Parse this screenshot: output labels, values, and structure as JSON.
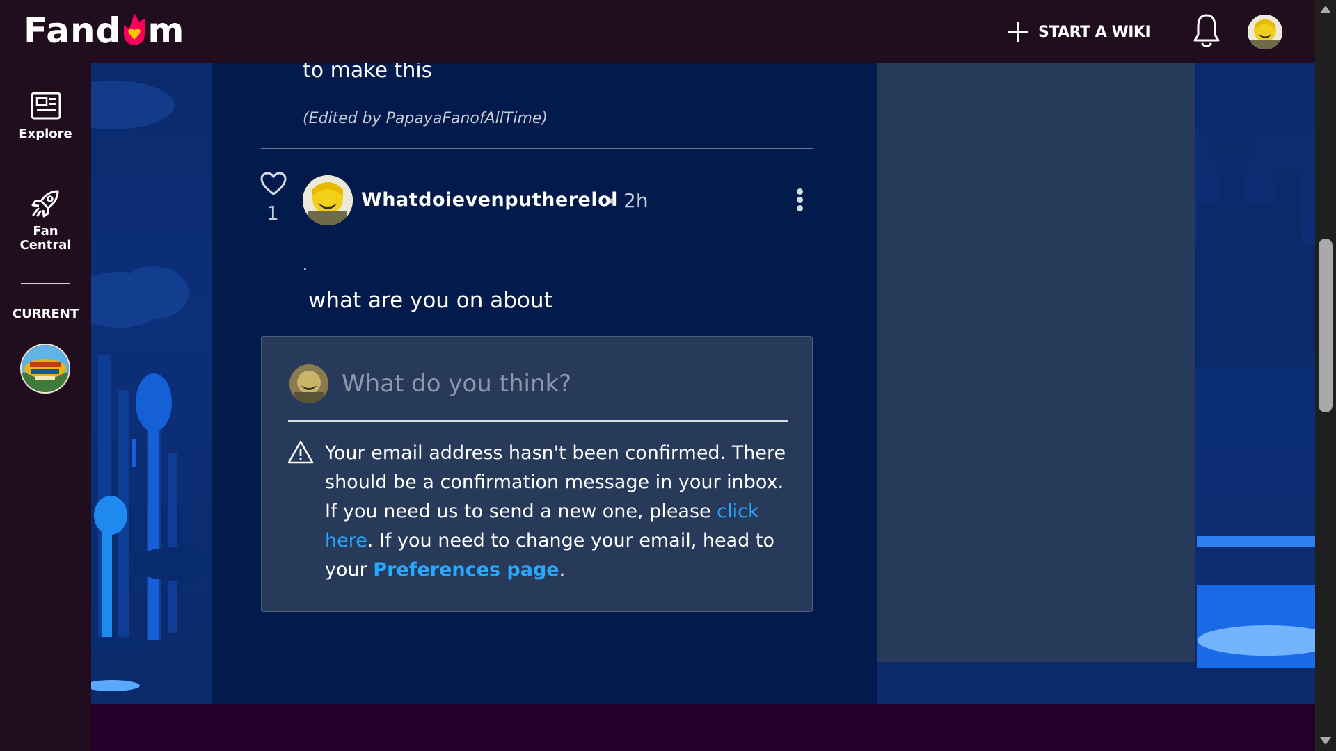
{
  "header": {
    "logo_text_left": "Fand",
    "logo_text_right": "m",
    "start_wiki_label": "START A WIKI",
    "icons": [
      "fandom-flame-icon",
      "plus-icon",
      "bell-icon",
      "user-avatar"
    ]
  },
  "rail": {
    "explore_label": "Explore",
    "fan_central_label_1": "Fan",
    "fan_central_label_2": "Central",
    "current_label": "CURRENT",
    "icons": [
      "explore-icon",
      "rocket-icon",
      "wiki-logo"
    ]
  },
  "thread": {
    "previous_reply_text": "to make this",
    "edited_note": "(Edited by PapayaFanofAllTime)",
    "post": {
      "likes": "1",
      "author": "Whatdoievenputherelol",
      "separator": "•",
      "time": "2h",
      "dot_line": ".",
      "body": "what are you on about"
    }
  },
  "reply": {
    "placeholder": "What do you think?",
    "warning": {
      "text_1": "Your email address hasn't been confirmed. There should be a confirmation message in your inbox. If you need us to send a new one, please ",
      "link_1": "click here",
      "text_2": ". If you need to change your email, head to your ",
      "link_2": "Preferences page",
      "text_3": "."
    }
  },
  "colors": {
    "topbar_bg": "#200d1e",
    "main_bg": "#021b4c",
    "panel_bg": "#283a5a",
    "link": "#26a9ff",
    "fandom_flame": "#fa005a"
  }
}
